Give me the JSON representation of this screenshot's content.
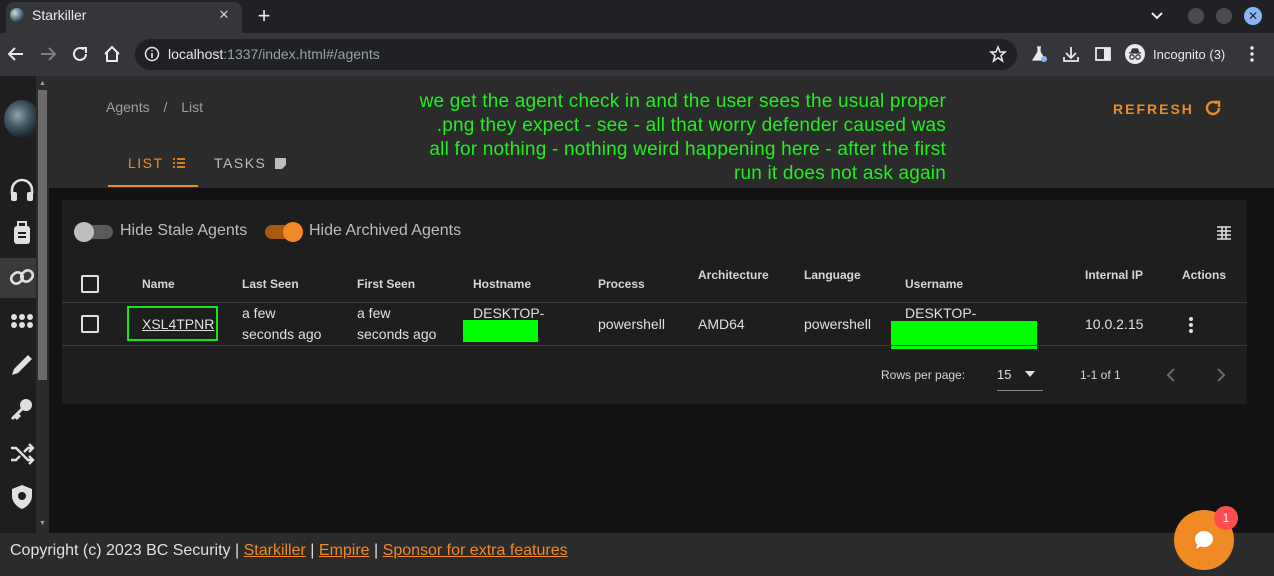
{
  "browser": {
    "tab_title": "Starkiller",
    "url_host": "localhost",
    "url_rest": ":1337/index.html#/agents",
    "profile_label": "Incognito (3)"
  },
  "breadcrumb": {
    "root": "Agents",
    "separator": "/",
    "current": "List"
  },
  "tabs": {
    "list": "LIST",
    "tasks": "TASKS"
  },
  "refresh_label": "REFRESH",
  "annotation": [
    "we get the agent check in and the user sees the usual proper",
    ".png they expect - see - all that worry defender caused was",
    "all for nothing - nothing weird happening here - after the first",
    "run it does not ask again"
  ],
  "filters": {
    "hide_stale": {
      "label": "Hide Stale Agents",
      "on": false
    },
    "hide_archived": {
      "label": "Hide Archived Agents",
      "on": true
    }
  },
  "table": {
    "headers": {
      "name": "Name",
      "last_seen": "Last Seen",
      "first_seen": "First Seen",
      "hostname": "Hostname",
      "process": "Process",
      "architecture": "Architecture",
      "language": "Language",
      "username": "Username",
      "internal_ip": "Internal IP",
      "actions": "Actions"
    },
    "rows": [
      {
        "name": "XSL4TPNR",
        "last_seen_1": "a few",
        "last_seen_2": "seconds ago",
        "first_seen_1": "a few",
        "first_seen_2": "seconds ago",
        "hostname": "DESKTOP-",
        "process": "powershell",
        "architecture": "AMD64",
        "language": "powershell",
        "username": "DESKTOP-",
        "internal_ip": "10.0.2.15"
      }
    ]
  },
  "pagination": {
    "rows_per_page_label": "Rows per page:",
    "rows_per_page": "15",
    "range": "1-1 of 1"
  },
  "footer": {
    "copyright": "Copyright (c) 2023 BC Security |",
    "sep": "|",
    "link_starkiller": "Starkiller",
    "link_empire": "Empire",
    "link_sponsor": "Sponsor for extra features"
  },
  "chat_badge": "1",
  "colors": {
    "accent": "#f08a24",
    "annotation": "#22ee22",
    "redaction": "#00ff00"
  }
}
